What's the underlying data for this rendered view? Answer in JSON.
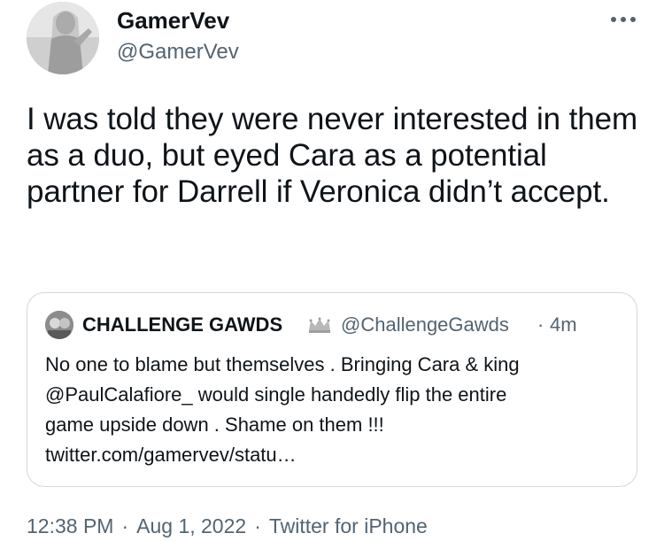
{
  "author": {
    "name": "GamerVev",
    "handle": "@GamerVev"
  },
  "tweet": {
    "text": "I was told they were never interested in them as a duo, but eyed Cara as a potential partner for Darrell if Veronica didn’t accept."
  },
  "quote": {
    "name": "CHALLENGE GAWDS",
    "handle": "@ChallengeGawds",
    "separator": "·",
    "time": "4m",
    "lines": [
      "No one to blame but themselves . Bringing Cara & king",
      "@PaulCalafiore_ would single handedly flip the entire",
      "game upside down . Shame on them !!!",
      "twitter.com/gamervev/statu…"
    ]
  },
  "meta": {
    "time": "12:38 PM",
    "separator": "·",
    "date": "Aug 1, 2022",
    "source": "Twitter for iPhone"
  },
  "icons": {
    "more": "more-horizontal-icon",
    "crown": "crown-icon"
  },
  "colors": {
    "text": "#0f1419",
    "secondary": "#536471",
    "border": "#cfd9de"
  }
}
